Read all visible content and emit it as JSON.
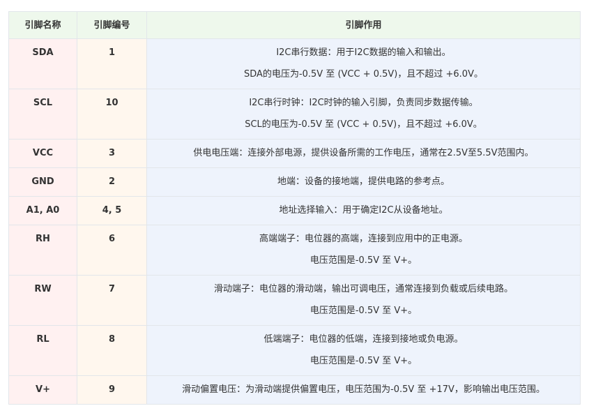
{
  "header": {
    "col_name": "引脚名称",
    "col_number": "引脚编号",
    "col_function": "引脚作用"
  },
  "rows": [
    {
      "name": "SDA",
      "number": "1",
      "lines": [
        "I2C串行数据：用于I2C数据的输入和输出。",
        "SDA的电压为-0.5V 至 (VCC + 0.5V)，且不超过 +6.0V。"
      ]
    },
    {
      "name": "SCL",
      "number": "10",
      "lines": [
        "I2C串行时钟：I2C时钟的输入引脚，负责同步数据传输。",
        "SCL的电压为-0.5V 至 (VCC + 0.5V)，且不超过 +6.0V。"
      ]
    },
    {
      "name": "VCC",
      "number": "3",
      "lines": [
        "供电电压端：连接外部电源，提供设备所需的工作电压，通常在2.5V至5.5V范围内。"
      ]
    },
    {
      "name": "GND",
      "number": "2",
      "lines": [
        "地端：设备的接地端，提供电路的参考点。"
      ]
    },
    {
      "name": "A1, A0",
      "number": "4, 5",
      "lines": [
        "地址选择输入：用于确定I2C从设备地址。"
      ]
    },
    {
      "name": "RH",
      "number": "6",
      "lines": [
        "高端端子：电位器的高端，连接到应用中的正电源。",
        "电压范围是-0.5V 至 V+。"
      ]
    },
    {
      "name": "RW",
      "number": "7",
      "lines": [
        "滑动端子：电位器的滑动端，输出可调电压，通常连接到负载或后续电路。",
        "电压范围是-0.5V 至 V+。"
      ]
    },
    {
      "name": "RL",
      "number": "8",
      "lines": [
        "低端端子：电位器的低端，连接到接地或负电源。",
        "电压范围是-0.5V 至 V+。"
      ]
    },
    {
      "name": "V+",
      "number": "9",
      "lines": [
        "滑动偏置电压：为滑动端提供偏置电压，电压范围为-0.5V 至 +17V，影响输出电压范围。"
      ]
    }
  ]
}
